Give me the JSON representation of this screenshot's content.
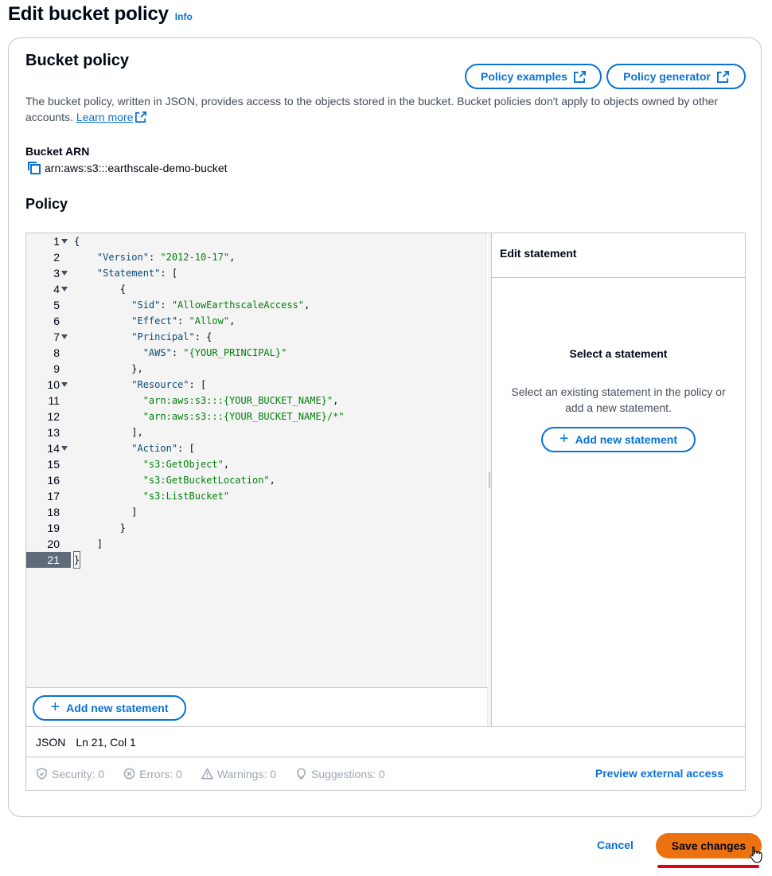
{
  "header": {
    "title": "Edit bucket policy",
    "info": "Info"
  },
  "container": {
    "title": "Bucket policy",
    "policy_examples_label": "Policy examples",
    "policy_generator_label": "Policy generator",
    "description": "The bucket policy, written in JSON, provides access to the objects stored in the bucket. Bucket policies don't apply to objects owned by other accounts.",
    "learn_more": "Learn more",
    "arn_label": "Bucket ARN",
    "arn_value": "arn:aws:s3:::earthscale-demo-bucket",
    "policy_heading": "Policy"
  },
  "editor": {
    "lines": [
      "{",
      "    \"Version\": \"2012-10-17\",",
      "    \"Statement\": [",
      "        {",
      "          \"Sid\": \"AllowEarthscaleAccess\",",
      "          \"Effect\": \"Allow\",",
      "          \"Principal\": {",
      "            \"AWS\": \"{YOUR_PRINCIPAL}\"",
      "          },",
      "          \"Resource\": [",
      "            \"arn:aws:s3:::{YOUR_BUCKET_NAME}\",",
      "            \"arn:aws:s3:::{YOUR_BUCKET_NAME}/*\"",
      "          ],",
      "          \"Action\": [",
      "            \"s3:GetObject\",",
      "            \"s3:GetBucketLocation\",",
      "            \"s3:ListBucket\"",
      "          ]",
      "        }",
      "    ]",
      "}"
    ],
    "foldable_lines": [
      1,
      3,
      4,
      7,
      10,
      14
    ],
    "active_line": 21,
    "add_statement_label": "Add new statement"
  },
  "side_panel": {
    "header": "Edit statement",
    "empty_title": "Select a statement",
    "empty_desc": "Select an existing statement in the policy or add a new statement.",
    "add_statement_label": "Add new statement"
  },
  "status": {
    "language": "JSON",
    "position": "Ln 21, Col 1"
  },
  "validation": {
    "security": "Security: 0",
    "errors": "Errors: 0",
    "warnings": "Warnings: 0",
    "suggestions": "Suggestions: 0",
    "preview": "Preview external access"
  },
  "footer": {
    "cancel": "Cancel",
    "save": "Save changes"
  },
  "colors": {
    "accent": "#0972d3",
    "primary_button": "#ec7211",
    "string": "#037f0c",
    "key": "#0a4a74"
  }
}
